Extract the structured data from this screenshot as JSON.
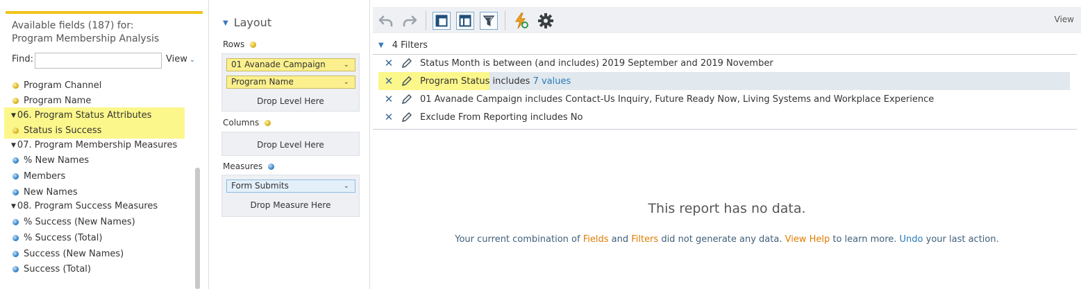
{
  "fields_panel": {
    "available_line1": "Available fields (187) for:",
    "available_line2": "Program Membership Analysis",
    "find_label": "Find:",
    "find_value": "",
    "view_label": "View",
    "items": [
      {
        "label": "Program Channel",
        "kind": "yellow"
      },
      {
        "label": "Program Name",
        "kind": "yellow"
      },
      {
        "label": "06. Program Status Attributes",
        "kind": "folder"
      },
      {
        "label": "Status is Success",
        "kind": "yellow"
      },
      {
        "label": "07. Program Membership Measures",
        "kind": "folder"
      },
      {
        "label": "% New Names",
        "kind": "blue"
      },
      {
        "label": "Members",
        "kind": "blue"
      },
      {
        "label": "New Names",
        "kind": "blue"
      },
      {
        "label": "08. Program Success Measures",
        "kind": "folder"
      },
      {
        "label": "% Success (New Names)",
        "kind": "blue"
      },
      {
        "label": "% Success (Total)",
        "kind": "blue"
      },
      {
        "label": "Success (New Names)",
        "kind": "blue"
      },
      {
        "label": "Success (Total)",
        "kind": "blue"
      }
    ]
  },
  "layout_panel": {
    "title": "Layout",
    "rows_label": "Rows",
    "rows_chips": [
      "01 Avanade Campaign",
      "Program Name"
    ],
    "rows_drop": "Drop Level Here",
    "columns_label": "Columns",
    "columns_drop": "Drop Level Here",
    "measures_label": "Measures",
    "measures_chips": [
      "Form Submits"
    ],
    "measures_drop": "Drop Measure Here"
  },
  "toolbar": {
    "view_label": "View",
    "icons": [
      "undo-icon",
      "redo-icon",
      "layout-icon",
      "table-icon",
      "filter-icon",
      "refresh-icon",
      "gear-icon"
    ]
  },
  "filters": {
    "count_label": "4 Filters",
    "rows": [
      {
        "field": "Status Month",
        "rest": " is between (and includes) 2019 September and 2019 November",
        "link": ""
      },
      {
        "field": "Program Status",
        "rest": " includes ",
        "link": "7 values"
      },
      {
        "field": "01 Avanade Campaign",
        "rest": " includes Contact-Us Inquiry, Future Ready Now, Living Systems and Workplace Experience",
        "link": ""
      },
      {
        "field": "Exclude From Reporting",
        "rest": " includes No",
        "link": ""
      }
    ]
  },
  "empty_state": {
    "title": "This report has no data.",
    "msg_1": "Your current combination of ",
    "fields_link": "Fields",
    "msg_2": " and ",
    "filters_link": "Filters",
    "msg_3": " did not generate any data. ",
    "help_link": "View Help",
    "msg_4": " to learn more. ",
    "undo_link": "Undo",
    "msg_5": " your last action."
  },
  "colors": {
    "highlight": "#fcf78a",
    "accent_bar": "#f0c419",
    "link_blue": "#2a7ab8",
    "link_orange": "#e07b00"
  }
}
